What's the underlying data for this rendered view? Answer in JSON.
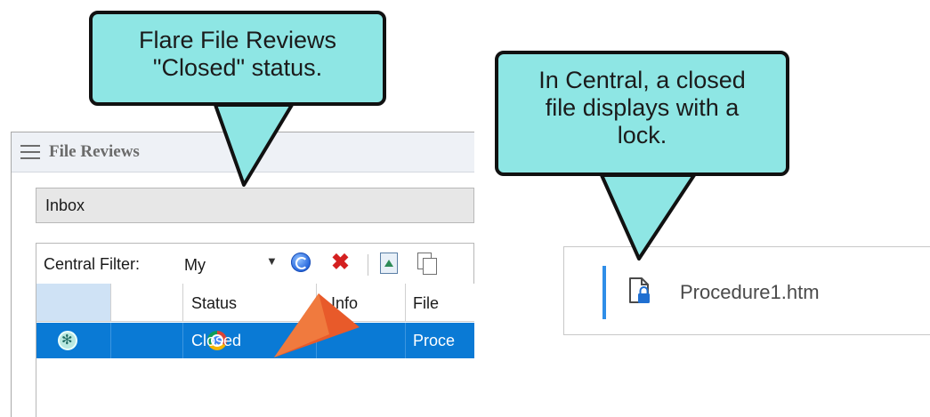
{
  "callouts": {
    "flare": {
      "line1": "Flare File Reviews",
      "line2": "\"Closed\" status."
    },
    "central": {
      "line1": "In Central, a closed",
      "line2": "file displays with a",
      "line3": "lock."
    }
  },
  "flare_panel": {
    "title": "File Reviews",
    "inbox_value": "Inbox",
    "filter_label": "Central Filter:",
    "filter_value": "My",
    "columns": [
      "",
      "",
      "Status",
      "Info",
      "File"
    ],
    "rows": [
      {
        "status": "Closed",
        "info": "",
        "file": "Proce",
        "selected": true
      }
    ]
  },
  "central_panel": {
    "file_name": "Procedure1.htm"
  },
  "icons": {
    "menu": "hamburger-icon",
    "refresh": "refresh-icon",
    "delete": "delete-x-icon",
    "upload": "upload-icon",
    "copy": "copy-icon",
    "review": "review-status-icon",
    "browser": "chrome-icon",
    "locked_file": "file-lock-icon"
  },
  "colors": {
    "callout_fill": "#8ee6e4",
    "selected_row": "#0a7ad5",
    "accent_bar": "#2f8ee8",
    "arrow": "#e85a2a"
  }
}
